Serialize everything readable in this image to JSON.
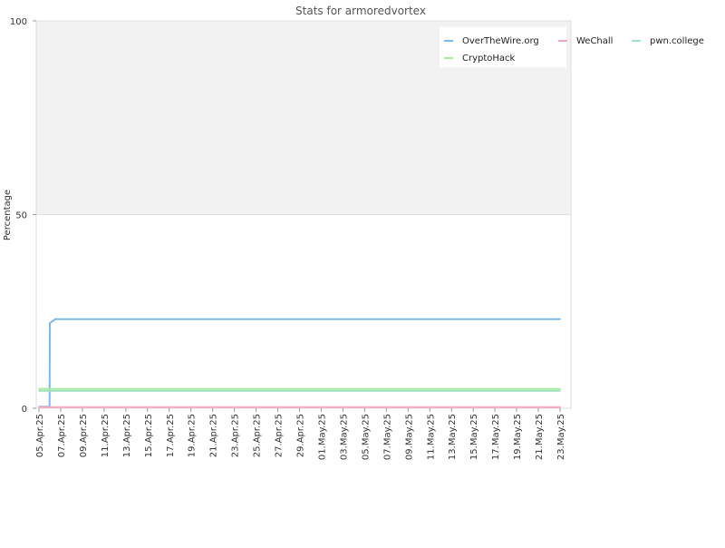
{
  "chart_data": {
    "type": "line",
    "title": "Stats for armoredvortex",
    "ylabel": "Percentage",
    "xlabel": "",
    "ylim": [
      0,
      100
    ],
    "y_ticks": [
      "0",
      "50",
      "100"
    ],
    "x_range": [
      "2025-04-05",
      "2025-05-23"
    ],
    "x_tick_labels": [
      "05.Apr.25",
      "07.Apr.25",
      "09.Apr.25",
      "11.Apr.25",
      "13.Apr.25",
      "15.Apr.25",
      "17.Apr.25",
      "19.Apr.25",
      "21.Apr.25",
      "23.Apr.25",
      "25.Apr.25",
      "27.Apr.25",
      "29.Apr.25",
      "01.May.25",
      "03.May.25",
      "05.May.25",
      "07.May.25",
      "09.May.25",
      "11.May.25",
      "13.May.25",
      "15.May.25",
      "17.May.25",
      "19.May.25",
      "21.May.25",
      "23.May.25"
    ],
    "x_tick_dates": [
      "2025-04-05",
      "2025-04-07",
      "2025-04-09",
      "2025-04-11",
      "2025-04-13",
      "2025-04-15",
      "2025-04-17",
      "2025-04-19",
      "2025-04-21",
      "2025-04-23",
      "2025-04-25",
      "2025-04-27",
      "2025-04-29",
      "2025-05-01",
      "2025-05-03",
      "2025-05-05",
      "2025-05-07",
      "2025-05-09",
      "2025-05-11",
      "2025-05-13",
      "2025-05-15",
      "2025-05-17",
      "2025-05-19",
      "2025-05-21",
      "2025-05-23"
    ],
    "grid": true,
    "legend_position": "top-right",
    "series": [
      {
        "name": "OverTheWire.org",
        "color": "#7eb6f0",
        "points": [
          [
            "2025-04-05",
            0.4
          ],
          [
            "2025-04-05T23:30",
            0.4
          ],
          [
            "2025-04-06",
            22.0
          ],
          [
            "2025-04-06T12:00",
            23.0
          ],
          [
            "2025-05-23",
            23.0
          ]
        ]
      },
      {
        "name": "WeChall",
        "color": "#f3a6bd",
        "points": [
          [
            "2025-04-05",
            0.3
          ],
          [
            "2025-05-23",
            0.3
          ]
        ]
      },
      {
        "name": "pwn.college",
        "color": "#9ee0c0",
        "points": [
          [
            "2025-04-05",
            4.5
          ],
          [
            "2025-05-23",
            4.5
          ]
        ]
      },
      {
        "name": "CryptoHack",
        "color": "#a8eca0",
        "points": [
          [
            "2025-04-05",
            5.0
          ],
          [
            "2025-05-23",
            5.0
          ]
        ]
      }
    ]
  }
}
